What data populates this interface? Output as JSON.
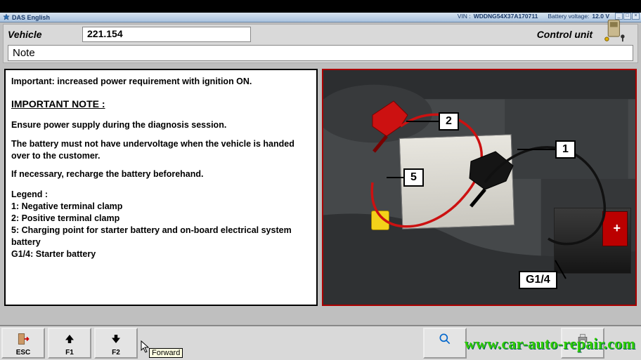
{
  "titlebar": {
    "app_name": "DAS English",
    "vin_label": "VIN :",
    "vin_value": "WDDNG54X37A170711",
    "battery_label": "Battery voltage:",
    "battery_value": "12.0 V"
  },
  "header": {
    "vehicle_label": "Vehicle",
    "vehicle_value": "221.154",
    "control_unit_label": "Control unit",
    "note_label": "Note"
  },
  "content": {
    "line1": "Important: increased power requirement with ignition ON.",
    "important_note_heading": "IMPORTANT NOTE :",
    "line2": "Ensure power supply during the diagnosis session.",
    "line3": "The battery must not have undervoltage when the vehicle is handed over to the customer.",
    "line4": "If necessary, recharge the battery beforehand.",
    "legend_heading": "Legend :",
    "legend1": "1: Negative terminal clamp",
    "legend2": "2: Positive terminal clamp",
    "legend5": "5: Charging point for starter battery and on-board electrical system battery",
    "legendG": "G1/4: Starter battery"
  },
  "image_callouts": {
    "c2": "2",
    "c1": "1",
    "c5": "5",
    "cG": "G1/4"
  },
  "bottombar": {
    "esc": "ESC",
    "f1": "F1",
    "f2": "F2",
    "tooltip": "Forward",
    "cursor_visible": true
  },
  "icons": {
    "app_star": "star-icon",
    "esc_icon": "door-exit-icon",
    "up_icon": "arrow-up-icon",
    "down_icon": "arrow-down-icon",
    "zoom_icon": "magnifier-icon",
    "print_icon": "printer-icon",
    "cu_icon": "control-unit-icon"
  },
  "watermark": "www.car-auto-repair.com"
}
